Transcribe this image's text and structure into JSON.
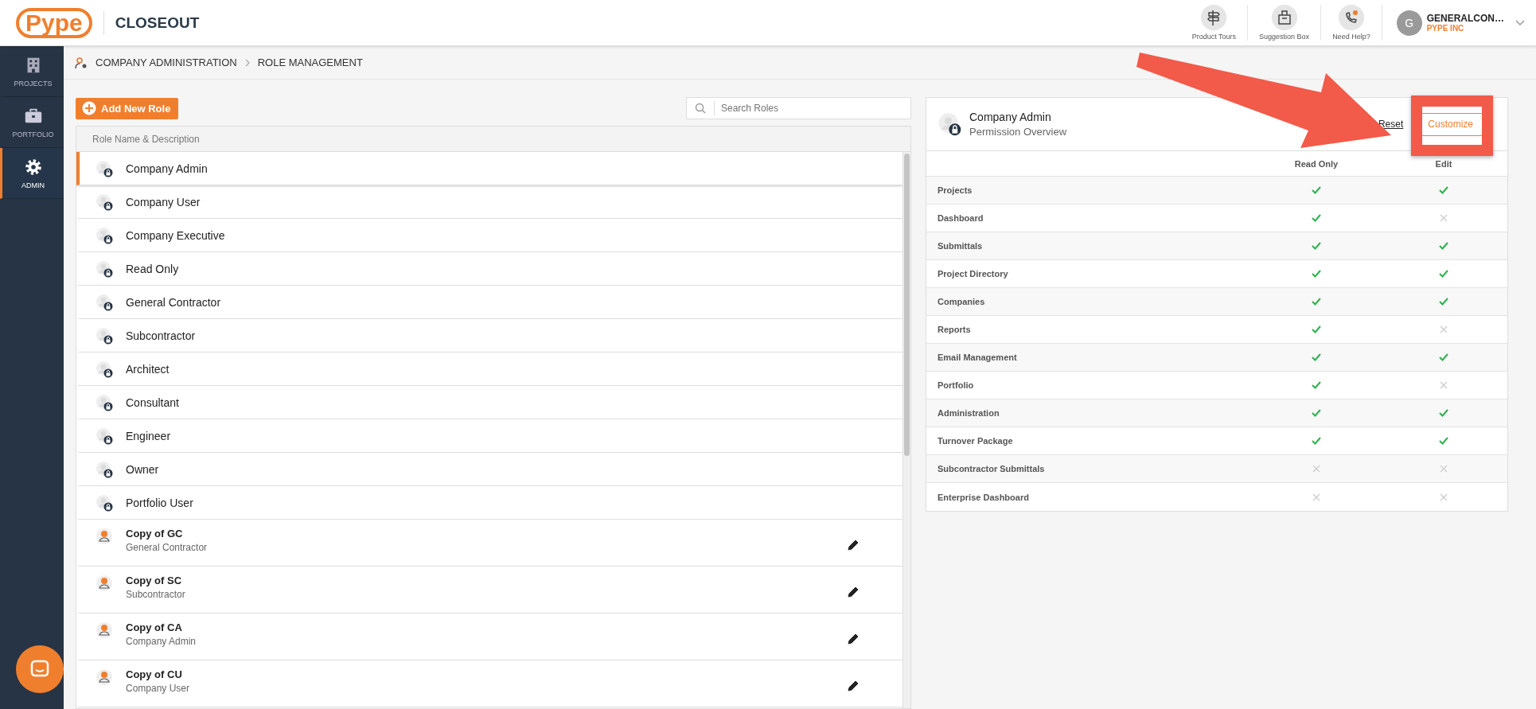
{
  "topbar": {
    "logo": "Pype",
    "product": "CLOSEOUT",
    "actions": [
      {
        "label": "Product Tours",
        "kind": "tours"
      },
      {
        "label": "Suggestion Box",
        "kind": "suggestion"
      },
      {
        "label": "Need Help?",
        "kind": "help"
      }
    ],
    "user": {
      "initial": "G",
      "name": "GENERALCON…",
      "company": "PYPE INC"
    }
  },
  "sidebar": {
    "items": [
      {
        "label": "PROJECTS",
        "kind": "projects",
        "selected": false
      },
      {
        "label": "PORTFOLIO",
        "kind": "portfolio",
        "selected": false
      },
      {
        "label": "ADMIN",
        "kind": "admin",
        "selected": true
      }
    ]
  },
  "breadcrumb": [
    "COMPANY ADMINISTRATION",
    "ROLE MANAGEMENT"
  ],
  "roles_panel": {
    "add_button": "Add New Role",
    "search": {
      "placeholder": "Search Roles"
    },
    "column": "Role Name & Description",
    "roles": [
      {
        "name": "Company Admin",
        "kind": "system",
        "selected": true
      },
      {
        "name": "Company User",
        "kind": "system",
        "selected": false
      },
      {
        "name": "Company Executive",
        "kind": "system",
        "selected": false
      },
      {
        "name": "Read Only",
        "kind": "system",
        "selected": false
      },
      {
        "name": "General Contractor",
        "kind": "system",
        "selected": false
      },
      {
        "name": "Subcontractor",
        "kind": "system",
        "selected": false
      },
      {
        "name": "Architect",
        "kind": "system",
        "selected": false
      },
      {
        "name": "Consultant",
        "kind": "system",
        "selected": false
      },
      {
        "name": "Engineer",
        "kind": "system",
        "selected": false
      },
      {
        "name": "Owner",
        "kind": "system",
        "selected": false
      },
      {
        "name": "Portfolio User",
        "kind": "system",
        "selected": false
      },
      {
        "name": "Copy of GC",
        "description": "General Contractor",
        "kind": "custom",
        "selected": false
      },
      {
        "name": "Copy of SC",
        "description": "Subcontractor",
        "kind": "custom",
        "selected": false
      },
      {
        "name": "Copy of CA",
        "description": "Company Admin",
        "kind": "custom",
        "selected": false
      },
      {
        "name": "Copy of CU",
        "description": "Company User",
        "kind": "custom",
        "selected": false
      }
    ]
  },
  "permission_panel": {
    "title": "Company Admin",
    "subtitle": "Permission Overview",
    "reset": "Reset",
    "customize": "Customize",
    "columns": [
      "Read Only",
      "Edit"
    ],
    "rows": [
      {
        "name": "Projects",
        "read_only": true,
        "edit": true
      },
      {
        "name": "Dashboard",
        "read_only": true,
        "edit": false
      },
      {
        "name": "Submittals",
        "read_only": true,
        "edit": true
      },
      {
        "name": "Project Directory",
        "read_only": true,
        "edit": true
      },
      {
        "name": "Companies",
        "read_only": true,
        "edit": true
      },
      {
        "name": "Reports",
        "read_only": true,
        "edit": false
      },
      {
        "name": "Email Management",
        "read_only": true,
        "edit": true
      },
      {
        "name": "Portfolio",
        "read_only": true,
        "edit": false
      },
      {
        "name": "Administration",
        "read_only": true,
        "edit": true
      },
      {
        "name": "Turnover Package",
        "read_only": true,
        "edit": true
      },
      {
        "name": "Subcontractor Submittals",
        "read_only": false,
        "edit": false
      },
      {
        "name": "Enterprise Dashboard",
        "read_only": false,
        "edit": false
      }
    ]
  }
}
